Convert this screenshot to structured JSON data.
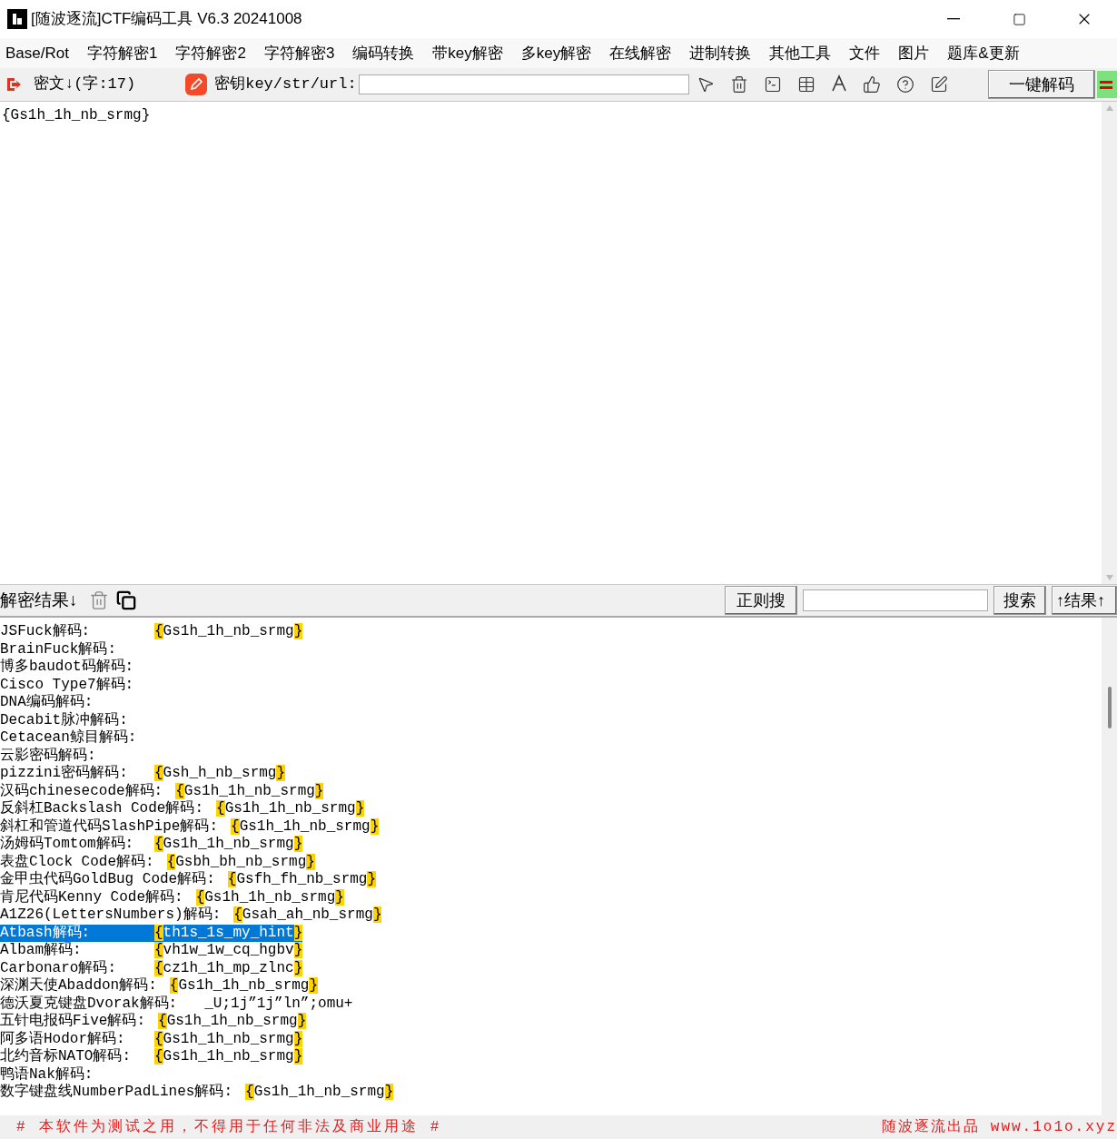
{
  "window": {
    "title": "[随波逐流]CTF编码工具 V6.3 20241008"
  },
  "menu": [
    "Base/Rot",
    "字符解密1",
    "字符解密2",
    "字符解密3",
    "编码转换",
    "带key解密",
    "多key解密",
    "在线解密",
    "进制转换",
    "其他工具",
    "文件",
    "图片",
    "题库&更新"
  ],
  "toolbar": {
    "cipher_label": "密文↓(字:17)",
    "key_label": "密钥key/str/url:",
    "decode_button": "一键解码"
  },
  "input": {
    "text": "{Gs1h_1h_nb_srmg}"
  },
  "results_bar": {
    "label": "解密结果↓",
    "regex_button": "正则搜",
    "search_button": "搜索",
    "results_button": "↑结果↑"
  },
  "results": [
    {
      "label": "JSFuck解码:",
      "value": "{Gs1h_1h_nb_srmg}",
      "selected": false
    },
    {
      "label": "BrainFuck解码:",
      "selected": false
    },
    {
      "label": "博多baudot码解码:",
      "selected": false
    },
    {
      "label": "Cisco Type7解码:",
      "selected": false
    },
    {
      "label": "DNA编码解码:",
      "selected": false
    },
    {
      "label": "Decabit脉冲解码:",
      "selected": false
    },
    {
      "label": "Cetacean鲸目解码:",
      "selected": false
    },
    {
      "label": "云影密码解码:",
      "selected": false
    },
    {
      "label": "pizzini密码解码:",
      "value": "{Gsh_h_nb_srmg}",
      "selected": false
    },
    {
      "label": "汉码chinesecode解码:",
      "value": "{Gs1h_1h_nb_srmg}",
      "selected": false
    },
    {
      "label": "反斜杠Backslash Code解码:",
      "value": "{Gs1h_1h_nb_srmg}",
      "selected": false
    },
    {
      "label": "斜杠和管道代码SlashPipe解码:",
      "value": "{Gs1h_1h_nb_srmg}",
      "selected": false
    },
    {
      "label": "汤姆码Tomtom解码:",
      "value": "{Gs1h_1h_nb_srmg}",
      "selected": false
    },
    {
      "label": "表盘Clock Code解码:",
      "value": "{Gsbh_bh_nb_srmg}",
      "selected": false
    },
    {
      "label": "金甲虫代码GoldBug Code解码:",
      "value": "{Gsfh_fh_nb_srmg}",
      "selected": false
    },
    {
      "label": "肯尼代码Kenny Code解码:",
      "value": "{Gs1h_1h_nb_srmg}",
      "selected": false
    },
    {
      "label": "A1Z26(LettersNumbers)解码:",
      "value": "{Gsah_ah_nb_srmg}",
      "selected": false
    },
    {
      "label": "Atbash解码:",
      "value": "{th1s_1s_my_hint}",
      "selected": true
    },
    {
      "label": "Albam解码:",
      "value": "{vh1w_1w_cq_hgbv}",
      "selected": false
    },
    {
      "label": "Carbonaro解码:",
      "value": "{cz1h_1h_mp_zlnc}",
      "selected": false
    },
    {
      "label": "深渊天使Abaddon解码:",
      "value": "{Gs1h_1h_nb_srmg}",
      "selected": false
    },
    {
      "label": "德沃夏克键盘Dvorak解码:",
      "plain": "_U;1j”1j”ln”;omu+",
      "selected": false
    },
    {
      "label": "五针电报码Five解码:",
      "value": "{Gs1h_1h_nb_srmg}",
      "selected": false
    },
    {
      "label": "阿多语Hodor解码:",
      "value": "{Gs1h_1h_nb_srmg}",
      "selected": false
    },
    {
      "label": "北约音标NATO解码:",
      "value": "{Gs1h_1h_nb_srmg}",
      "selected": false
    },
    {
      "label": "鸭语Nak解码:",
      "selected": false
    },
    {
      "label": "数字键盘线NumberPadLines解码:",
      "value": "{Gs1h_1h_nb_srmg}",
      "selected": false
    }
  ],
  "status": {
    "left": "# 本软件为测试之用，不得用于任何非法及商业用途 #",
    "right": "随波逐流出品 www.1o1o.xyz"
  }
}
